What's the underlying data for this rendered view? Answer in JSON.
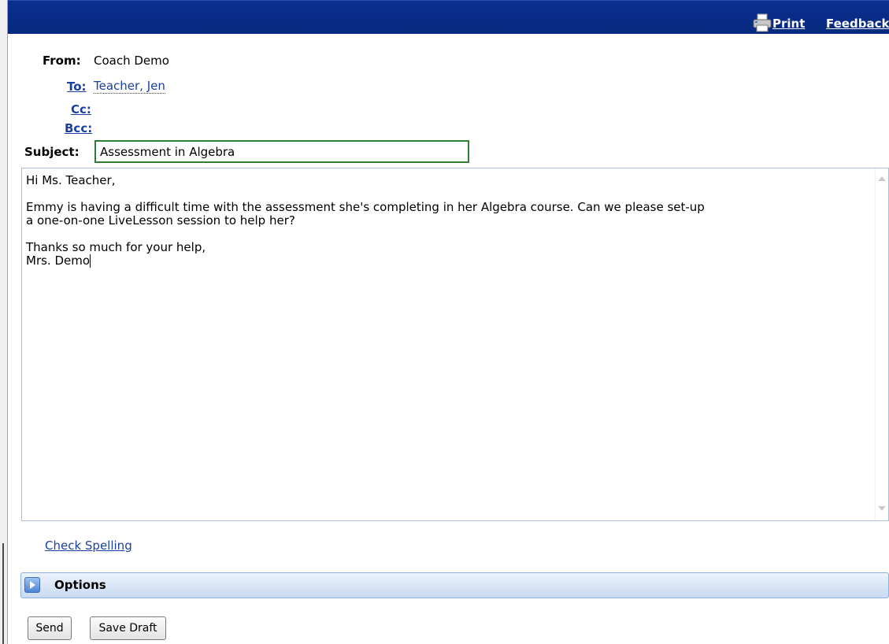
{
  "toolbar": {
    "print_label": "Print",
    "feedback_label": "Feedback",
    "print_icon": "printer-icon"
  },
  "header": {
    "from_label": "From:",
    "from_value": "Coach Demo",
    "to_label": "To:",
    "to_recipients": [
      "Teacher, Jen"
    ],
    "cc_label": "Cc:",
    "bcc_label": "Bcc:",
    "subject_label": "Subject:",
    "subject_value": "Assessment in Algebra"
  },
  "message": {
    "body": "Hi Ms. Teacher,\n\nEmmy is having a difficult time with the assessment she's completing in her Algebra course. Can we please set-up\na one-on-one LiveLesson session to help her?\n\nThanks so much for your help,\nMrs. Demo"
  },
  "links": {
    "check_spelling": "Check Spelling"
  },
  "options": {
    "label": "Options",
    "expanded": false
  },
  "actions": {
    "send_label": "Send",
    "save_draft_label": "Save Draft"
  },
  "colors": {
    "topbar": "#06297f",
    "link": "#1a3fa3",
    "subject_border": "#2e7d32"
  }
}
